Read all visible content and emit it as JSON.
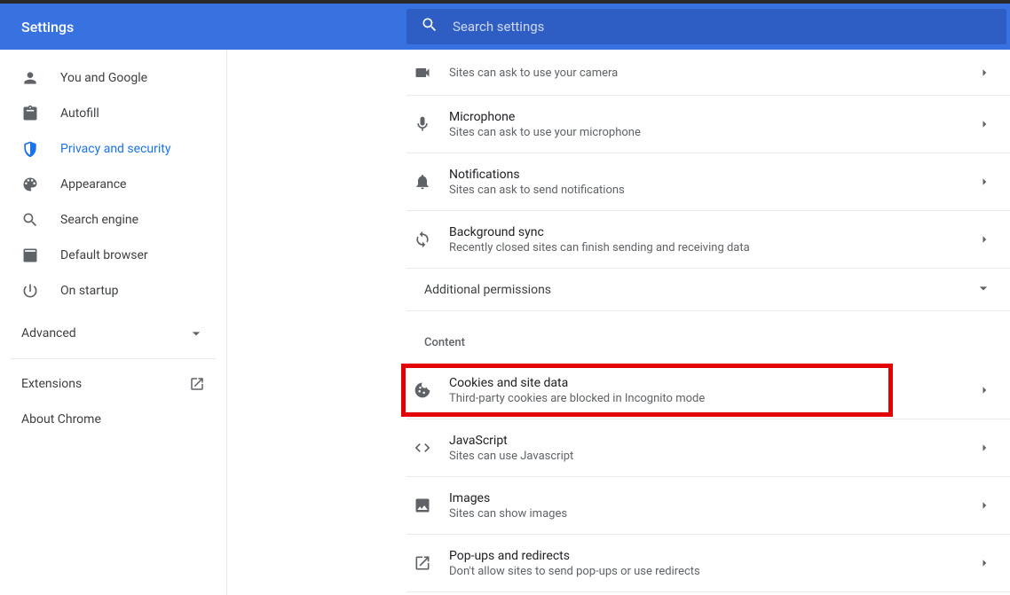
{
  "header": {
    "title": "Settings",
    "search_placeholder": "Search settings"
  },
  "sidebar": {
    "items": [
      {
        "label": "You and Google"
      },
      {
        "label": "Autofill"
      },
      {
        "label": "Privacy and security"
      },
      {
        "label": "Appearance"
      },
      {
        "label": "Search engine"
      },
      {
        "label": "Default browser"
      },
      {
        "label": "On startup"
      }
    ],
    "advanced": "Advanced",
    "extensions": "Extensions",
    "about": "About Chrome"
  },
  "main": {
    "permissions": [
      {
        "title": "",
        "sub": "Sites can ask to use your camera"
      },
      {
        "title": "Microphone",
        "sub": "Sites can ask to use your microphone"
      },
      {
        "title": "Notifications",
        "sub": "Sites can ask to send notifications"
      },
      {
        "title": "Background sync",
        "sub": "Recently closed sites can finish sending and receiving data"
      }
    ],
    "additional": "Additional permissions",
    "content_label": "Content",
    "content": [
      {
        "title": "Cookies and site data",
        "sub": "Third-party cookies are blocked in Incognito mode"
      },
      {
        "title": "JavaScript",
        "sub": "Sites can use Javascript"
      },
      {
        "title": "Images",
        "sub": "Sites can show images"
      },
      {
        "title": "Pop-ups and redirects",
        "sub": "Don't allow sites to send pop-ups or use redirects"
      }
    ]
  }
}
